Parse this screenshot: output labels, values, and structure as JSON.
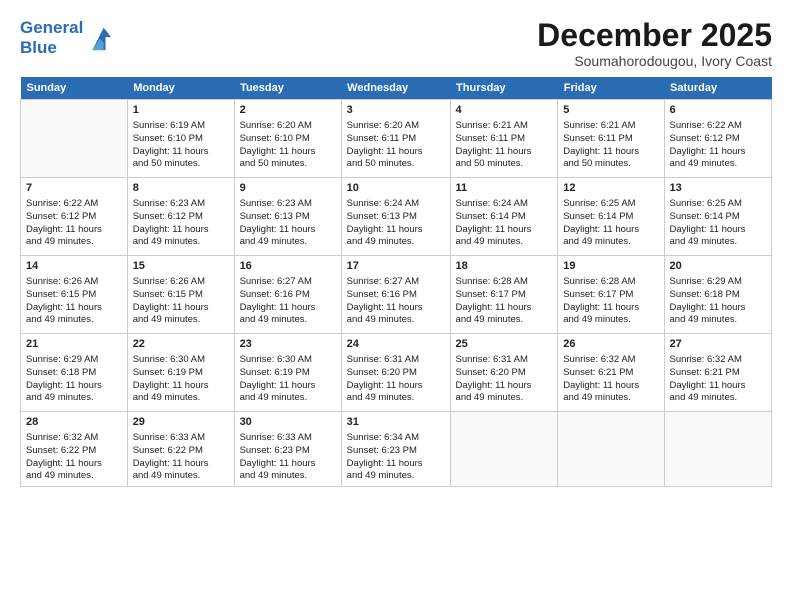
{
  "header": {
    "logo_line1": "General",
    "logo_line2": "Blue",
    "month": "December 2025",
    "location": "Soumahorodougou, Ivory Coast"
  },
  "weekdays": [
    "Sunday",
    "Monday",
    "Tuesday",
    "Wednesday",
    "Thursday",
    "Friday",
    "Saturday"
  ],
  "weeks": [
    [
      {
        "day": "",
        "text": ""
      },
      {
        "day": "1",
        "text": "Sunrise: 6:19 AM\nSunset: 6:10 PM\nDaylight: 11 hours\nand 50 minutes."
      },
      {
        "day": "2",
        "text": "Sunrise: 6:20 AM\nSunset: 6:10 PM\nDaylight: 11 hours\nand 50 minutes."
      },
      {
        "day": "3",
        "text": "Sunrise: 6:20 AM\nSunset: 6:11 PM\nDaylight: 11 hours\nand 50 minutes."
      },
      {
        "day": "4",
        "text": "Sunrise: 6:21 AM\nSunset: 6:11 PM\nDaylight: 11 hours\nand 50 minutes."
      },
      {
        "day": "5",
        "text": "Sunrise: 6:21 AM\nSunset: 6:11 PM\nDaylight: 11 hours\nand 50 minutes."
      },
      {
        "day": "6",
        "text": "Sunrise: 6:22 AM\nSunset: 6:12 PM\nDaylight: 11 hours\nand 49 minutes."
      }
    ],
    [
      {
        "day": "7",
        "text": "Sunrise: 6:22 AM\nSunset: 6:12 PM\nDaylight: 11 hours\nand 49 minutes."
      },
      {
        "day": "8",
        "text": "Sunrise: 6:23 AM\nSunset: 6:12 PM\nDaylight: 11 hours\nand 49 minutes."
      },
      {
        "day": "9",
        "text": "Sunrise: 6:23 AM\nSunset: 6:13 PM\nDaylight: 11 hours\nand 49 minutes."
      },
      {
        "day": "10",
        "text": "Sunrise: 6:24 AM\nSunset: 6:13 PM\nDaylight: 11 hours\nand 49 minutes."
      },
      {
        "day": "11",
        "text": "Sunrise: 6:24 AM\nSunset: 6:14 PM\nDaylight: 11 hours\nand 49 minutes."
      },
      {
        "day": "12",
        "text": "Sunrise: 6:25 AM\nSunset: 6:14 PM\nDaylight: 11 hours\nand 49 minutes."
      },
      {
        "day": "13",
        "text": "Sunrise: 6:25 AM\nSunset: 6:14 PM\nDaylight: 11 hours\nand 49 minutes."
      }
    ],
    [
      {
        "day": "14",
        "text": "Sunrise: 6:26 AM\nSunset: 6:15 PM\nDaylight: 11 hours\nand 49 minutes."
      },
      {
        "day": "15",
        "text": "Sunrise: 6:26 AM\nSunset: 6:15 PM\nDaylight: 11 hours\nand 49 minutes."
      },
      {
        "day": "16",
        "text": "Sunrise: 6:27 AM\nSunset: 6:16 PM\nDaylight: 11 hours\nand 49 minutes."
      },
      {
        "day": "17",
        "text": "Sunrise: 6:27 AM\nSunset: 6:16 PM\nDaylight: 11 hours\nand 49 minutes."
      },
      {
        "day": "18",
        "text": "Sunrise: 6:28 AM\nSunset: 6:17 PM\nDaylight: 11 hours\nand 49 minutes."
      },
      {
        "day": "19",
        "text": "Sunrise: 6:28 AM\nSunset: 6:17 PM\nDaylight: 11 hours\nand 49 minutes."
      },
      {
        "day": "20",
        "text": "Sunrise: 6:29 AM\nSunset: 6:18 PM\nDaylight: 11 hours\nand 49 minutes."
      }
    ],
    [
      {
        "day": "21",
        "text": "Sunrise: 6:29 AM\nSunset: 6:18 PM\nDaylight: 11 hours\nand 49 minutes."
      },
      {
        "day": "22",
        "text": "Sunrise: 6:30 AM\nSunset: 6:19 PM\nDaylight: 11 hours\nand 49 minutes."
      },
      {
        "day": "23",
        "text": "Sunrise: 6:30 AM\nSunset: 6:19 PM\nDaylight: 11 hours\nand 49 minutes."
      },
      {
        "day": "24",
        "text": "Sunrise: 6:31 AM\nSunset: 6:20 PM\nDaylight: 11 hours\nand 49 minutes."
      },
      {
        "day": "25",
        "text": "Sunrise: 6:31 AM\nSunset: 6:20 PM\nDaylight: 11 hours\nand 49 minutes."
      },
      {
        "day": "26",
        "text": "Sunrise: 6:32 AM\nSunset: 6:21 PM\nDaylight: 11 hours\nand 49 minutes."
      },
      {
        "day": "27",
        "text": "Sunrise: 6:32 AM\nSunset: 6:21 PM\nDaylight: 11 hours\nand 49 minutes."
      }
    ],
    [
      {
        "day": "28",
        "text": "Sunrise: 6:32 AM\nSunset: 6:22 PM\nDaylight: 11 hours\nand 49 minutes."
      },
      {
        "day": "29",
        "text": "Sunrise: 6:33 AM\nSunset: 6:22 PM\nDaylight: 11 hours\nand 49 minutes."
      },
      {
        "day": "30",
        "text": "Sunrise: 6:33 AM\nSunset: 6:23 PM\nDaylight: 11 hours\nand 49 minutes."
      },
      {
        "day": "31",
        "text": "Sunrise: 6:34 AM\nSunset: 6:23 PM\nDaylight: 11 hours\nand 49 minutes."
      },
      {
        "day": "",
        "text": ""
      },
      {
        "day": "",
        "text": ""
      },
      {
        "day": "",
        "text": ""
      }
    ]
  ]
}
